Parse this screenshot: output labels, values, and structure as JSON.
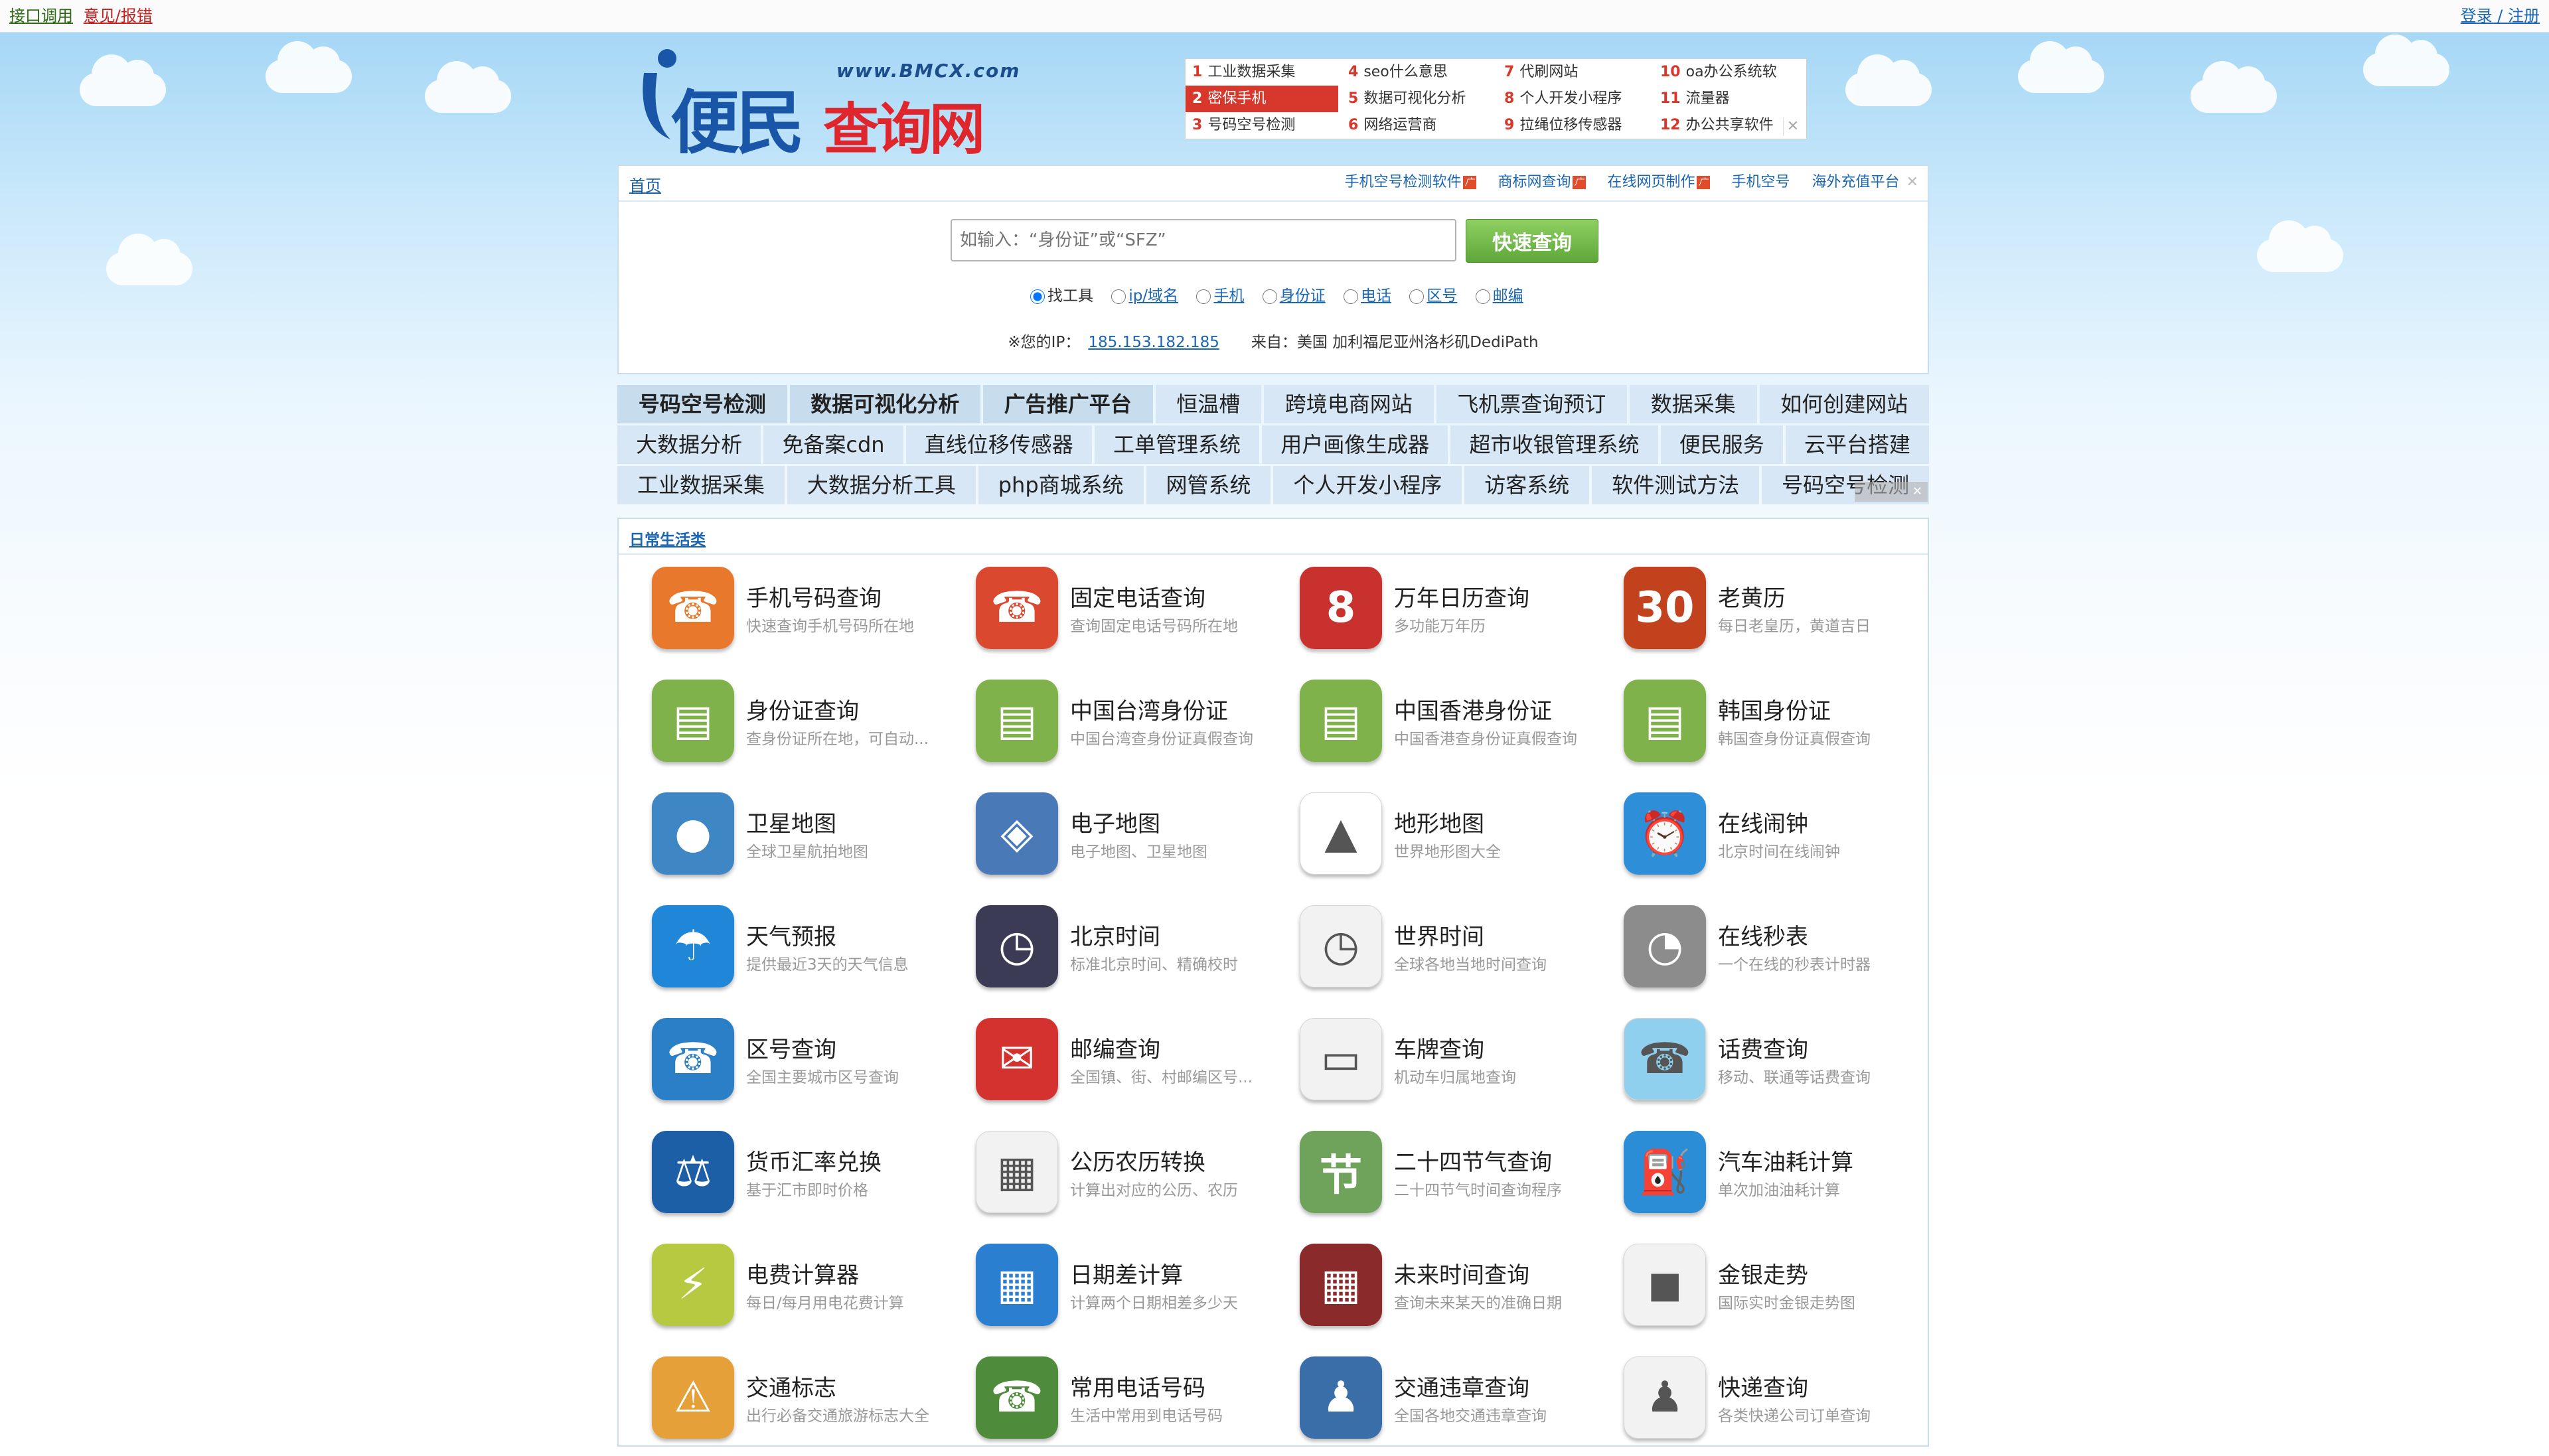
{
  "topbar": {
    "api_link": "接口调用",
    "feedback_link": "意见/报错",
    "login_link": "登录 / 注册"
  },
  "logo": {
    "url_text": "www.BMCX.com",
    "name_part1": "便民",
    "name_part2": "查询网"
  },
  "hot_list": [
    {
      "num": "1",
      "label": "工业数据采集",
      "selected": false
    },
    {
      "num": "2",
      "label": "密保手机",
      "selected": true
    },
    {
      "num": "3",
      "label": "号码空号检测",
      "selected": false
    },
    {
      "num": "4",
      "label": "seo什么意思",
      "selected": false
    },
    {
      "num": "5",
      "label": "数据可视化分析",
      "selected": false
    },
    {
      "num": "6",
      "label": "网络运营商",
      "selected": false
    },
    {
      "num": "7",
      "label": "代刷网站",
      "selected": false
    },
    {
      "num": "8",
      "label": "个人开发小程序",
      "selected": false
    },
    {
      "num": "9",
      "label": "拉绳位移传感器",
      "selected": false
    },
    {
      "num": "10",
      "label": "oa办公系统软",
      "selected": false
    },
    {
      "num": "11",
      "label": "流量器",
      "selected": false
    },
    {
      "num": "12",
      "label": "办公共享软件",
      "selected": false
    }
  ],
  "breadcrumb": {
    "home": "首页"
  },
  "promo_links": [
    "手机空号检测软件",
    "商标网查询",
    "在线网页制作",
    "手机空号",
    "海外充值平台"
  ],
  "search": {
    "placeholder": "如输入：“身份证”或“SFZ”",
    "button": "快速查询",
    "radios": [
      {
        "label": "找工具",
        "checked": true,
        "link": false
      },
      {
        "label": "ip/域名",
        "checked": false,
        "link": true
      },
      {
        "label": "手机",
        "checked": false,
        "link": true
      },
      {
        "label": "身份证",
        "checked": false,
        "link": true
      },
      {
        "label": "电话",
        "checked": false,
        "link": true
      },
      {
        "label": "区号",
        "checked": false,
        "link": true
      },
      {
        "label": "邮编",
        "checked": false,
        "link": true
      }
    ],
    "ip_label": "※您的IP：",
    "ip": "185.153.182.185",
    "from_label": "来自：",
    "from_value": "美国 加利福尼亚州洛杉矶DediPath"
  },
  "tag_rows": [
    [
      {
        "t": "号码空号检测",
        "b": true
      },
      {
        "t": "数据可视化分析",
        "b": true
      },
      {
        "t": "广告推广平台",
        "b": true
      },
      {
        "t": "恒温槽"
      },
      {
        "t": "跨境电商网站"
      },
      {
        "t": "飞机票查询预订"
      },
      {
        "t": "数据采集"
      },
      {
        "t": "如何创建网站"
      }
    ],
    [
      {
        "t": "大数据分析"
      },
      {
        "t": "免备案cdn"
      },
      {
        "t": "直线位移传感器"
      },
      {
        "t": "工单管理系统"
      },
      {
        "t": "用户画像生成器"
      },
      {
        "t": "超市收银管理系统"
      },
      {
        "t": "便民服务"
      },
      {
        "t": "云平台搭建"
      }
    ],
    [
      {
        "t": "工业数据采集"
      },
      {
        "t": "大数据分析工具"
      },
      {
        "t": "php商城系统"
      },
      {
        "t": "网管系统"
      },
      {
        "t": "个人开发小程序"
      },
      {
        "t": "访客系统"
      },
      {
        "t": "软件测试方法"
      },
      {
        "t": "号码空号检测"
      }
    ]
  ],
  "category": {
    "title": "日常生活类",
    "items": [
      {
        "title": "手机号码查询",
        "desc": "快速查询手机号码所在地",
        "icon": "phone-icon",
        "glyph": "☎",
        "color": "#e8782c"
      },
      {
        "title": "固定电话查询",
        "desc": "查询固定电话号码所在地",
        "icon": "telephone-icon",
        "glyph": "☎",
        "color": "#d9482f"
      },
      {
        "title": "万年日历查询",
        "desc": "多功能万年历",
        "icon": "calendar-icon",
        "glyph": "8",
        "color": "#c8312d"
      },
      {
        "title": "老黄历",
        "desc": "每日老皇历，黄道吉日",
        "icon": "almanac-icon",
        "glyph": "30",
        "color": "#c2421e"
      },
      {
        "title": "身份证查询",
        "desc": "查身份证所在地，可自动...",
        "icon": "id-card-icon",
        "glyph": "▤",
        "color": "#7fb24a"
      },
      {
        "title": "中国台湾身份证",
        "desc": "中国台湾查身份证真假查询",
        "icon": "id-card-tw-icon",
        "glyph": "▤",
        "color": "#7fb24a"
      },
      {
        "title": "中国香港身份证",
        "desc": "中国香港查身份证真假查询",
        "icon": "id-card-hk-icon",
        "glyph": "▤",
        "color": "#7fb24a"
      },
      {
        "title": "韩国身份证",
        "desc": "韩国查身份证真假查询",
        "icon": "id-card-kr-icon",
        "glyph": "▤",
        "color": "#7fb24a"
      },
      {
        "title": "卫星地图",
        "desc": "全球卫星航拍地图",
        "icon": "satellite-map-icon",
        "glyph": "●",
        "color": "#3f86c4"
      },
      {
        "title": "电子地图",
        "desc": "电子地图、卫星地图",
        "icon": "map-icon",
        "glyph": "◈",
        "color": "#4a79b8"
      },
      {
        "title": "地形地图",
        "desc": "世界地形图大全",
        "icon": "terrain-icon",
        "glyph": "▲",
        "color": "#ffffff"
      },
      {
        "title": "在线闹钟",
        "desc": "北京时间在线闹钟",
        "icon": "alarm-clock-icon",
        "glyph": "⏰",
        "color": "#2f8ed8"
      },
      {
        "title": "天气预报",
        "desc": "提供最近3天的天气信息",
        "icon": "weather-icon",
        "glyph": "☂",
        "color": "#1f86d8"
      },
      {
        "title": "北京时间",
        "desc": "标准北京时间、精确校时",
        "icon": "clock-icon",
        "glyph": "◷",
        "color": "#3b3b55"
      },
      {
        "title": "世界时间",
        "desc": "全球各地当地时间查询",
        "icon": "world-clock-icon",
        "glyph": "◷",
        "color": "#f2f2f2"
      },
      {
        "title": "在线秒表",
        "desc": "一个在线的秒表计时器",
        "icon": "stopwatch-icon",
        "glyph": "◔",
        "color": "#8c8c8c"
      },
      {
        "title": "区号查询",
        "desc": "全国主要城市区号查询",
        "icon": "area-code-icon",
        "glyph": "☎",
        "color": "#2b7fc6"
      },
      {
        "title": "邮编查询",
        "desc": "全国镇、街、村邮编区号...",
        "icon": "postcode-icon",
        "glyph": "✉",
        "color": "#d4322f"
      },
      {
        "title": "车牌查询",
        "desc": "机动车归属地查询",
        "icon": "license-plate-icon",
        "glyph": "▭",
        "color": "#f2f2f2"
      },
      {
        "title": "话费查询",
        "desc": "移动、联通等话费查询",
        "icon": "phone-bill-icon",
        "glyph": "☎",
        "color": "#8fd0ee"
      },
      {
        "title": "货币汇率兑换",
        "desc": "基于汇市即时价格",
        "icon": "scale-icon",
        "glyph": "⚖",
        "color": "#1c5fa6"
      },
      {
        "title": "公历农历转换",
        "desc": "计算出对应的公历、农历",
        "icon": "lunar-calendar-icon",
        "glyph": "▦",
        "color": "#f2f2f2"
      },
      {
        "title": "二十四节气查询",
        "desc": "二十四节气时间查询程序",
        "icon": "solar-term-icon",
        "glyph": "节",
        "color": "#6fa25a"
      },
      {
        "title": "汽车油耗计算",
        "desc": "单次加油油耗计算",
        "icon": "fuel-can-icon",
        "glyph": "⛽",
        "color": "#2a8dd6"
      },
      {
        "title": "电费计算器",
        "desc": "每日/每月用电花费计算",
        "icon": "electricity-icon",
        "glyph": "⚡",
        "color": "#b6c940"
      },
      {
        "title": "日期差计算",
        "desc": "计算两个日期相差多少天",
        "icon": "date-diff-icon",
        "glyph": "▦",
        "color": "#2a7fd0"
      },
      {
        "title": "未来时间查询",
        "desc": "查询未来某天的准确日期",
        "icon": "future-date-icon",
        "glyph": "▦",
        "color": "#8b2a2a"
      },
      {
        "title": "金银走势",
        "desc": "国际实时金银走势图",
        "icon": "gold-silver-icon",
        "glyph": "◼",
        "color": "#f2f2f2"
      },
      {
        "title": "交通标志",
        "desc": "出行必备交通旅游标志大全",
        "icon": "traffic-sign-icon",
        "glyph": "⚠",
        "color": "#e6a03a"
      },
      {
        "title": "常用电话号码",
        "desc": "生活中常用到电话号码",
        "icon": "phonebook-icon",
        "glyph": "☎",
        "color": "#4e8b3a"
      },
      {
        "title": "交通违章查询",
        "desc": "全国各地交通违章查询",
        "icon": "traffic-police-icon",
        "glyph": "♟",
        "color": "#3a6ea8"
      },
      {
        "title": "快递查询",
        "desc": "各类快递公司订单查询",
        "icon": "courier-icon",
        "glyph": "♟",
        "color": "#f2f2f2"
      }
    ]
  }
}
